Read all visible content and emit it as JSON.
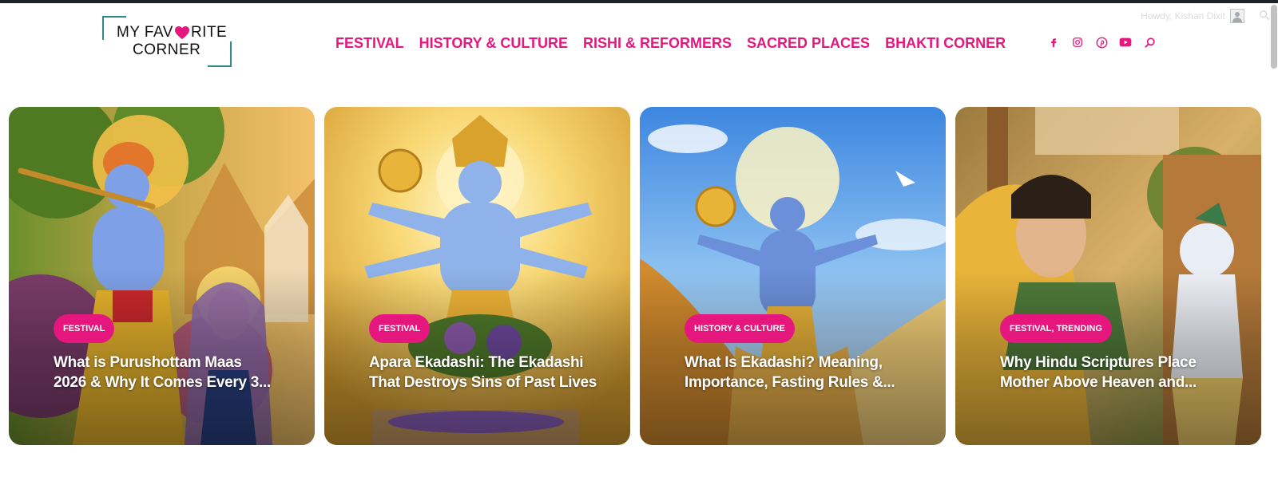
{
  "admin": {
    "greeting": "Howdy, Kishan Dixit"
  },
  "site": {
    "logo_line1_a": "MY FAV",
    "logo_line1_b": "RITE",
    "logo_line2": "CORNER"
  },
  "nav": [
    {
      "label": "FESTIVAL"
    },
    {
      "label": "HISTORY & CULTURE"
    },
    {
      "label": "RISHI & REFORMERS"
    },
    {
      "label": "SACRED PLACES"
    },
    {
      "label": "BHAKTI CORNER"
    }
  ],
  "socials": [
    "facebook-icon",
    "instagram-icon",
    "pinterest-icon",
    "youtube-icon",
    "search-icon"
  ],
  "colors": {
    "accent": "#e5177e",
    "logo_frame": "#2f8a8a",
    "admin_bar": "#1d2327"
  },
  "cards": [
    {
      "category": "FESTIVAL",
      "title_line1": "What is Purushottam Maas",
      "title_line2": "2026 & Why It Comes Every 3..."
    },
    {
      "category": "FESTIVAL",
      "title_line1": "Apara Ekadashi: The Ekadashi",
      "title_line2": "That Destroys Sins of Past Lives"
    },
    {
      "category": "HISTORY & CULTURE",
      "title_line1": "What Is Ekadashi? Meaning,",
      "title_line2": "Importance, Fasting Rules &..."
    },
    {
      "category": "FESTIVAL, TRENDING",
      "title_line1": "Why Hindu Scriptures Place",
      "title_line2": "Mother Above Heaven and..."
    }
  ]
}
